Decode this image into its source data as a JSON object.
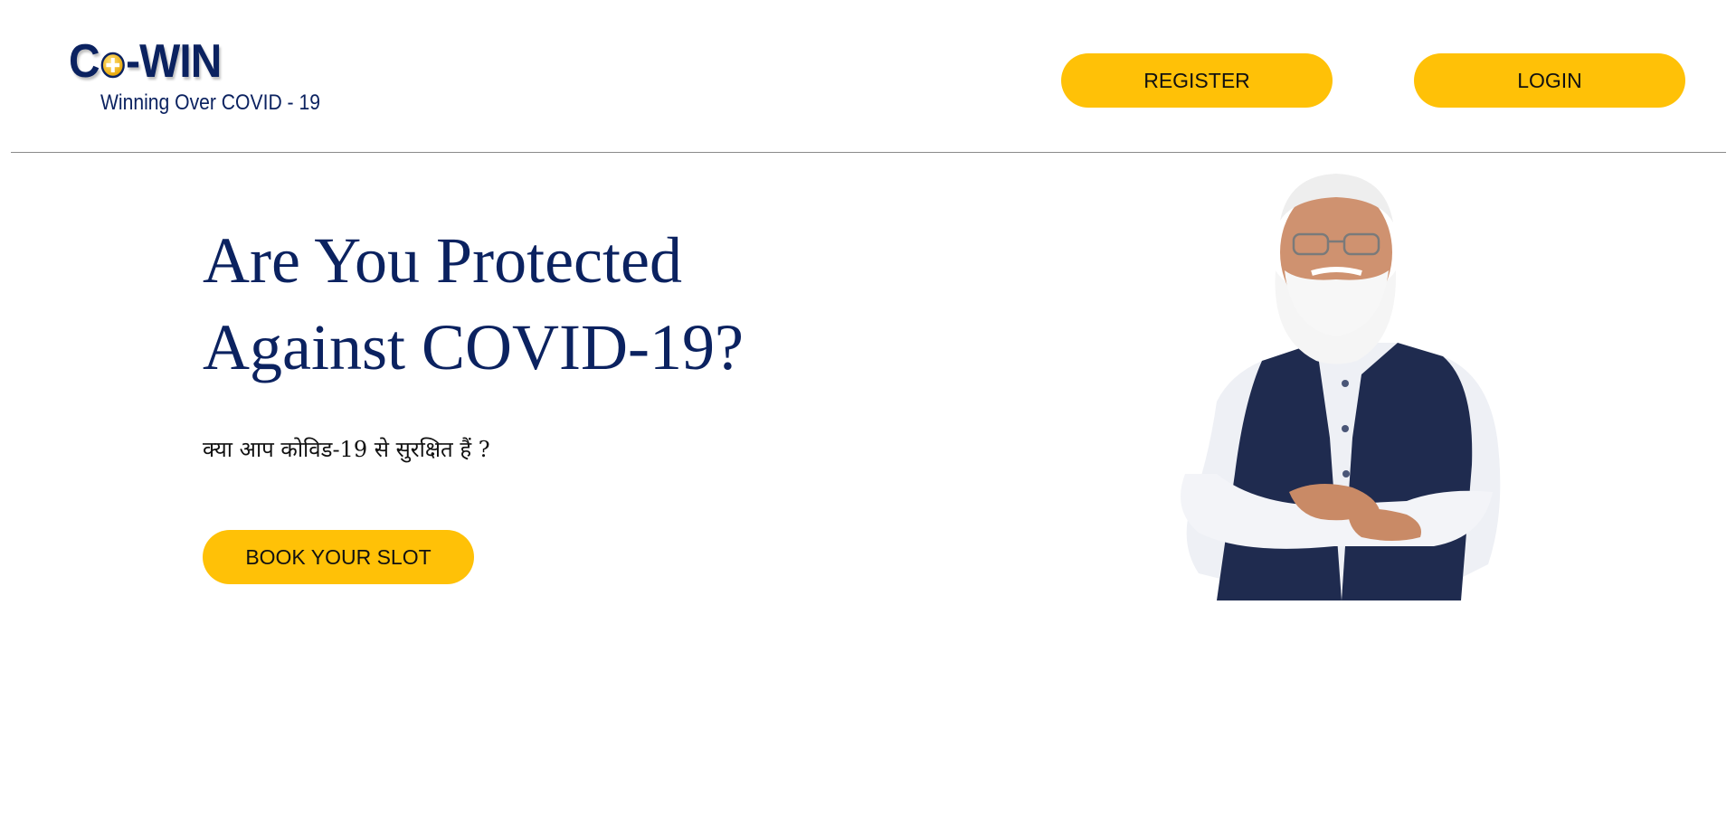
{
  "header": {
    "logo": {
      "brand_prefix": "C",
      "brand_suffix": "-WIN",
      "tagline": "Winning Over COVID - 19"
    },
    "register_label": "REGISTER",
    "login_label": "LOGIN"
  },
  "hero": {
    "headline": "Are You Protected Against COVID-19?",
    "subheadline_hindi": "क्या आप कोविड-19 से सुरक्षित हैं ?",
    "cta_label": "BOOK YOUR SLOT"
  },
  "colors": {
    "brand_navy": "#0b2260",
    "accent_yellow": "#ffc107",
    "divider": "#8a8a8a"
  },
  "icons": {
    "logo_mark": "plus-in-circle-icon",
    "portrait": "person-portrait"
  }
}
